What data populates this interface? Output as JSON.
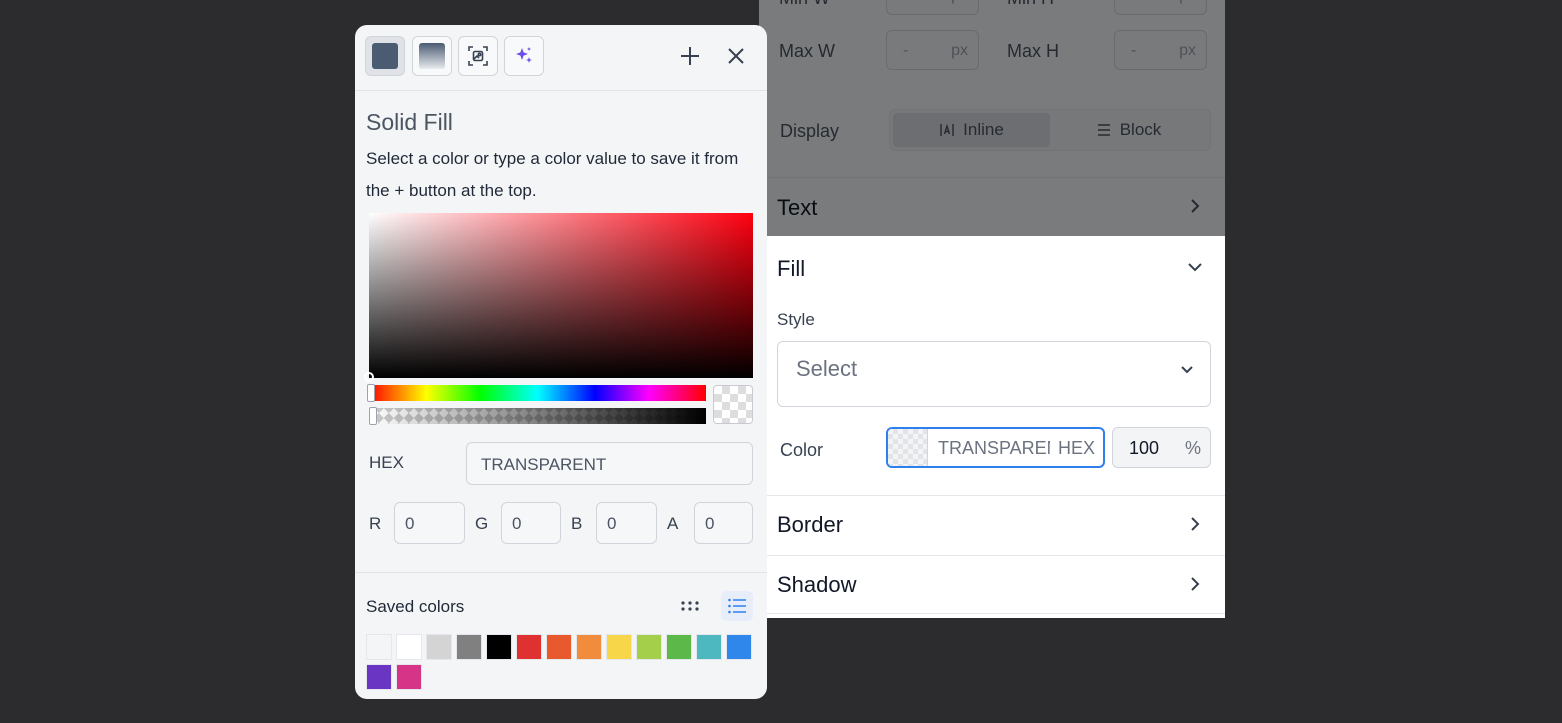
{
  "panel": {
    "min_w_label": "Min W",
    "min_h_label": "Min H",
    "max_w_label": "Max W",
    "max_h_label": "Max H",
    "dash": "-",
    "unit": "px",
    "display_label": "Display",
    "display_options": [
      "Inline",
      "Block"
    ],
    "display_selected": "Inline",
    "text_section": "Text",
    "fill_section": "Fill",
    "style_label": "Style",
    "style_placeholder": "Select",
    "color_label": "Color",
    "color_value": "TRANSPARENT",
    "color_format": "HEX",
    "opacity_value": "100",
    "opacity_unit": "%",
    "border_section": "Border",
    "shadow_section": "Shadow"
  },
  "picker": {
    "toolbar_icons": [
      "solid-fill-icon",
      "gradient-fill-icon",
      "image-fill-icon",
      "ai-sparkle-icon",
      "plus-icon",
      "close-icon"
    ],
    "title": "Solid Fill",
    "description": "Select a color or type a color value to save it from the + button at the top.",
    "hex_label": "HEX",
    "hex_value": "TRANSPARENT",
    "channels": [
      {
        "label": "R",
        "value": "0"
      },
      {
        "label": "G",
        "value": "0"
      },
      {
        "label": "B",
        "value": "0"
      },
      {
        "label": "A",
        "value": "0"
      }
    ],
    "hue_position": 0,
    "alpha_position": 0,
    "saved_colors_label": "Saved colors",
    "saved_colors": [
      "#f4f5f7",
      "#ffffff",
      "#d4d4d4",
      "#808080",
      "#000000",
      "#e03131",
      "#e8592e",
      "#f08c3c",
      "#f7d64a",
      "#a3cf4b",
      "#5db84a",
      "#4db8c0",
      "#2f86eb",
      "#6a35c2",
      "#d63486"
    ]
  },
  "colors": {
    "accent": "#2f80ed",
    "background": "#2c2c2e",
    "panel": "#ffffff",
    "picker": "#f4f5f7"
  }
}
